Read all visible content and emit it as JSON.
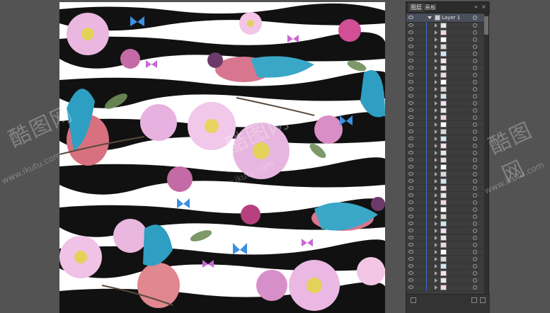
{
  "layers_panel": {
    "tabs": [
      {
        "label": "图层",
        "active": true
      },
      {
        "label": "画板",
        "active": false
      }
    ],
    "top_layer": {
      "name": "Layer 1"
    }
  },
  "watermark": {
    "logo_text": "酷图网",
    "url_text": "www.ikutu.com"
  },
  "colors": {
    "workspace_bg": "#535353",
    "panel_bg": "#3c3c3c",
    "selection_blue": "#3d6bd9"
  }
}
